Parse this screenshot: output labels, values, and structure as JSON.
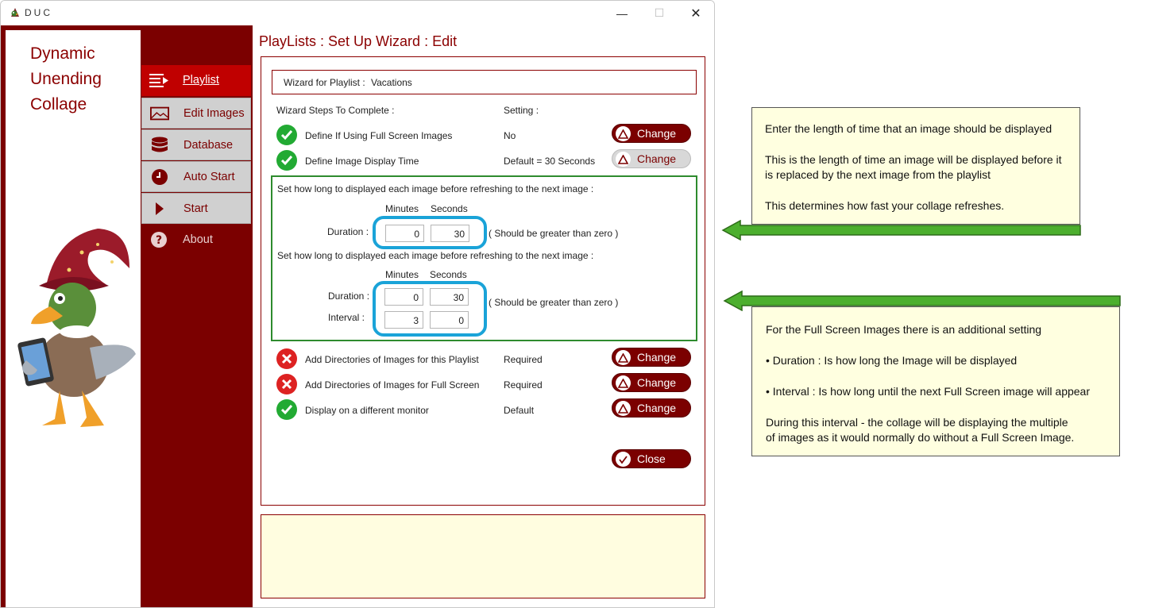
{
  "window": {
    "title": "DUC",
    "controls": {
      "minimize": "—",
      "maximize": "☐",
      "close": "✕"
    }
  },
  "logo": {
    "lines": [
      "Dynamic",
      "Unending",
      "Collage"
    ]
  },
  "sidebar": {
    "items": [
      {
        "label": "Playlist",
        "icon": "list-icon",
        "state": "active"
      },
      {
        "label": "Edit Images",
        "icon": "image-icon",
        "state": "normal"
      },
      {
        "label": "Database",
        "icon": "database-icon",
        "state": "normal"
      },
      {
        "label": "Auto Start",
        "icon": "clock-icon",
        "state": "normal"
      },
      {
        "label": "Start",
        "icon": "play-icon",
        "state": "normal"
      },
      {
        "label": "About",
        "icon": "help-icon",
        "state": "plain"
      }
    ]
  },
  "main": {
    "title": "PlayLists : Set Up Wizard : Edit",
    "playlist_label": "Wizard for Playlist :",
    "playlist_name": "Vacations",
    "steps_header": "Wizard Steps To Complete :",
    "setting_header": "Setting :",
    "steps": [
      {
        "label": "Define If Using Full Screen Images",
        "setting": "No",
        "status": "ok",
        "button": "Change",
        "enabled": true
      },
      {
        "label": "Define Image Display Time",
        "setting": "Default = 30 Seconds",
        "status": "ok",
        "button": "Change",
        "enabled": false
      },
      {
        "label": "Add Directories of Images for this Playlist",
        "setting": "Required",
        "status": "error",
        "button": "Change",
        "enabled": true
      },
      {
        "label": "Add Directories of Images for Full Screen",
        "setting": "Required",
        "status": "error",
        "button": "Change",
        "enabled": true
      },
      {
        "label": "Display on a different monitor",
        "setting": "Default",
        "status": "ok",
        "button": "Change",
        "enabled": true
      }
    ],
    "display_time": {
      "instruction": "Set how long to displayed each image before refreshing to the next image :",
      "minutes_label": "Minutes",
      "seconds_label": "Seconds",
      "duration_label": "Duration :",
      "minutes": "0",
      "seconds": "30",
      "hint": "( Should be greater than zero )"
    },
    "fullscreen_time": {
      "instruction": "Set how long to displayed each image before refreshing to the next image :",
      "minutes_label": "Minutes",
      "seconds_label": "Seconds",
      "duration_label": "Duration :",
      "interval_label": "Interval :",
      "duration_minutes": "0",
      "duration_seconds": "30",
      "interval_minutes": "3",
      "interval_seconds": "0",
      "hint": "( Should be greater than zero )"
    },
    "close_button": "Close"
  },
  "callouts": {
    "top": [
      "Enter the length of time that an image should  be displayed",
      "This is the length of time an image will be displayed before it",
      "is replaced by the next image from the playlist",
      "This determines how fast your collage refreshes."
    ],
    "bottom": [
      "For the Full Screen Images there is an additional setting",
      "•  Duration : Is how long the Image will be displayed",
      "•  Interval : Is how long until the next Full Screen image will appear",
      "During this interval - the collage will be displaying the multiple",
      "of images as it would normally do without a Full Screen Image."
    ]
  },
  "colors": {
    "brand_dark_red": "#7b0000",
    "active_red": "#c00000",
    "ok_green": "#22aa33",
    "error_red": "#dd2222",
    "highlight_blue": "#1aa3d8",
    "arrow_green": "#4caf2e",
    "callout_bg": "#ffffe0"
  }
}
